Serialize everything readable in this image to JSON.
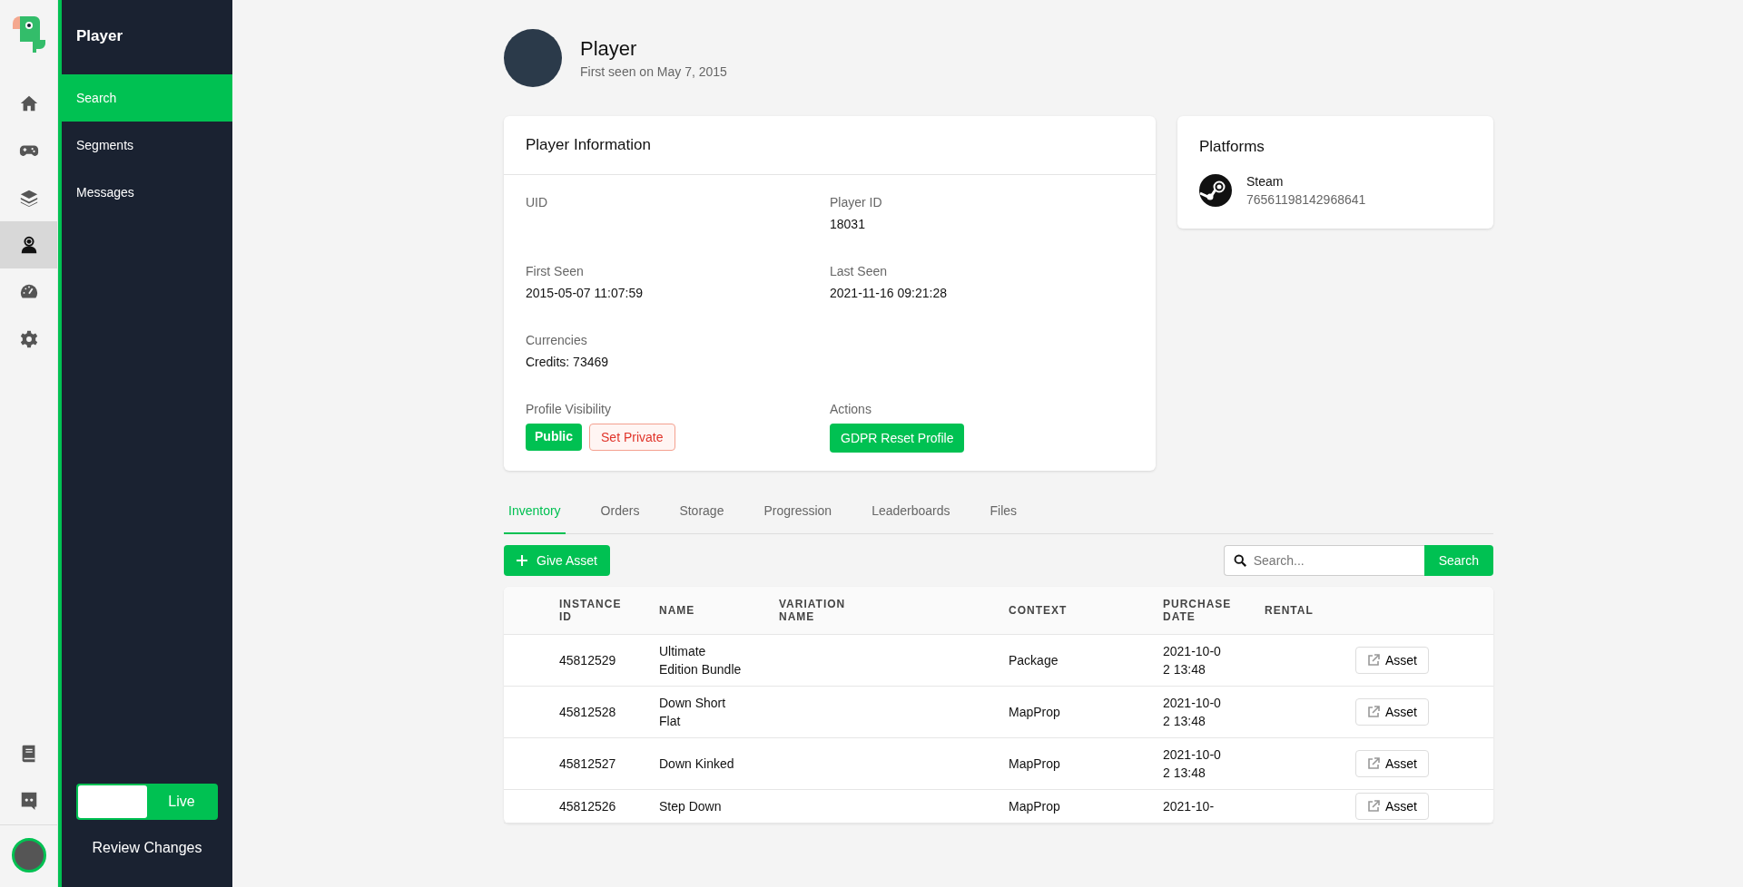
{
  "rail": {
    "items": [
      {
        "kind": "home",
        "selected": false
      },
      {
        "kind": "gamepad",
        "selected": false
      },
      {
        "kind": "layers",
        "selected": false
      },
      {
        "kind": "user",
        "selected": true
      },
      {
        "kind": "gauge",
        "selected": false
      },
      {
        "kind": "gear",
        "selected": false
      }
    ],
    "bottom_items": [
      {
        "kind": "book"
      },
      {
        "kind": "chat"
      }
    ]
  },
  "sidebar": {
    "title": "Player",
    "items": [
      {
        "label": "Search",
        "selected": true
      },
      {
        "label": "Segments",
        "selected": false
      },
      {
        "label": "Messages",
        "selected": false
      }
    ],
    "toggle": {
      "label": "Live",
      "on": true
    },
    "review": "Review Changes"
  },
  "header": {
    "name": "Player",
    "subtitle": "First seen on May 7, 2015"
  },
  "player_information": {
    "title": "Player Information",
    "fields": [
      {
        "label": "UID"
      },
      {
        "label": "Player ID",
        "value": "18031"
      },
      {
        "label": "First Seen",
        "value": "2015-05-07 11:07:59"
      },
      {
        "label": "Last Seen",
        "value": "2021-11-16 09:21:28"
      },
      {
        "label": "Currencies",
        "value": "Credits: 73469"
      }
    ],
    "visibility": {
      "label": "Profile Visibility",
      "badge": "Public",
      "button": "Set Private"
    },
    "actions": {
      "label": "Actions",
      "button": "GDPR Reset Profile"
    }
  },
  "platforms": {
    "title": "Platforms",
    "items": [
      {
        "name": "Steam",
        "id": "76561198142968641"
      }
    ]
  },
  "tabs": [
    {
      "label": "Inventory",
      "selected": true
    },
    {
      "label": "Orders",
      "selected": false
    },
    {
      "label": "Storage",
      "selected": false
    },
    {
      "label": "Progression",
      "selected": false
    },
    {
      "label": "Leaderboards",
      "selected": false
    },
    {
      "label": "Files",
      "selected": false
    }
  ],
  "toolbar": {
    "give_button": "Give Asset",
    "search": {
      "placeholder": "Search..."
    },
    "search_button": "Search"
  },
  "table": {
    "columns": [
      "INSTANCE ID",
      "NAME",
      "VARIATION NAME",
      "CONTEXT",
      "PURCHASE DATE",
      "RENTAL"
    ],
    "rows": [
      {
        "instance_id": "45812529",
        "name": "Ultimate Edition Bundle",
        "context": "Package",
        "purchase_date": "2021-10-02 13:48",
        "action": "Asset"
      },
      {
        "instance_id": "45812528",
        "name": "Down Short Flat",
        "context": "MapProp",
        "purchase_date": "2021-10-02 13:48",
        "action": "Asset"
      },
      {
        "instance_id": "45812527",
        "name": "Down Kinked",
        "context": "MapProp",
        "purchase_date": "2021-10-02 13:48",
        "action": "Asset"
      },
      {
        "instance_id": "45812526",
        "name": "Step Down",
        "context": "MapProp",
        "purchase_date": "2021-10-",
        "action": "Asset"
      }
    ]
  }
}
